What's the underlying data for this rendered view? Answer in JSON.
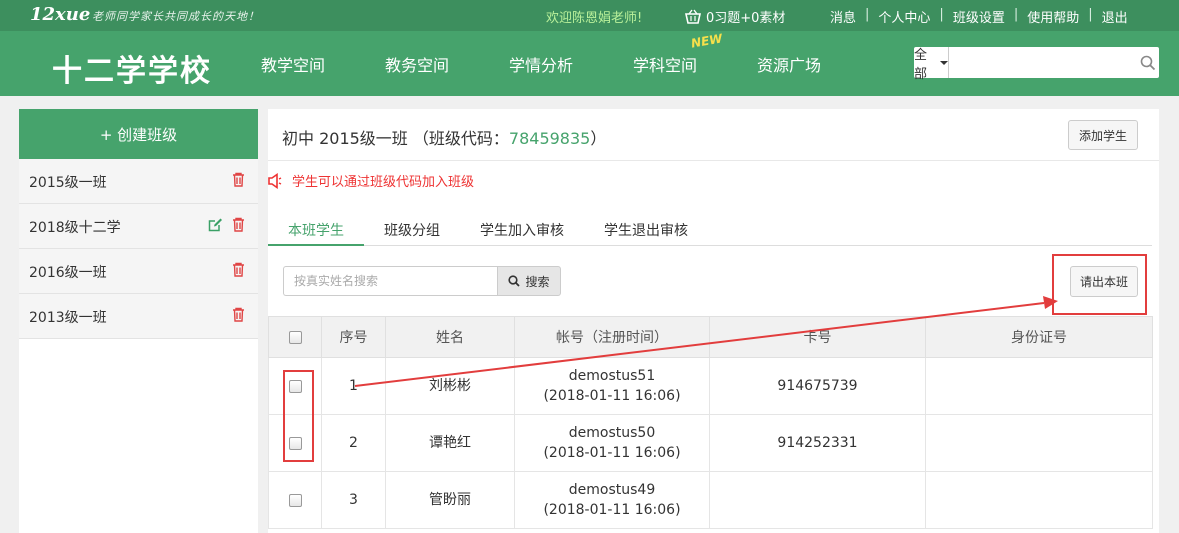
{
  "colors": {
    "top_strip": "#3d8f5e",
    "brand_green": "#46a36c",
    "alert_red": "#e33333",
    "annotation_red": "#e23d3d"
  },
  "topbar": {
    "logo": "12xue",
    "slogan": "老师同学家长共同成长的天地！",
    "welcome": "欢迎陈恩娟老师!",
    "basket_icon": "shopping-basket-icon",
    "basket_text": "0习题+0素材",
    "links": [
      "消息",
      "个人中心",
      "班级设置",
      "使用帮助",
      "退出"
    ]
  },
  "header": {
    "school": "十二学学校",
    "nav": [
      "教学空间",
      "教务空间",
      "学情分析",
      "学科空间",
      "资源广场"
    ],
    "new_badge": "NEW",
    "search_scope": "全部",
    "search_placeholder": "",
    "search_icon": "magnifier-icon"
  },
  "sidebar": {
    "create_label": "+ 创建班级",
    "classes": [
      {
        "name": "2015级一班",
        "editable": false
      },
      {
        "name": "2018级十二学",
        "editable": true
      },
      {
        "name": "2016级一班",
        "editable": false
      },
      {
        "name": "2013级一班",
        "editable": false
      }
    ]
  },
  "content": {
    "title_prefix": "初中 2015级一班 （班级代码：",
    "class_code": "78459835",
    "title_suffix": "）",
    "add_student": "添加学生",
    "notice": "学生可以通过班级代码加入班级",
    "tabs": [
      "本班学生",
      "班级分组",
      "学生加入审核",
      "学生退出审核"
    ],
    "active_tab": 0,
    "search_placeholder": "按真实姓名搜索",
    "search_button": "搜索",
    "kick_button": "请出本班",
    "table": {
      "headers": [
        "序号",
        "姓名",
        "帐号（注册时间）",
        "卡号",
        "身份证号"
      ],
      "rows": [
        {
          "no": "1",
          "name": "刘彬彬",
          "account": "demostus51",
          "time": "(2018-01-11 16:06)",
          "card": "914675739",
          "id": ""
        },
        {
          "no": "2",
          "name": "谭艳红",
          "account": "demostus50",
          "time": "(2018-01-11 16:06)",
          "card": "914252331",
          "id": ""
        },
        {
          "no": "3",
          "name": "管盼丽",
          "account": "demostus49",
          "time": "(2018-01-11 16:06)",
          "card": "",
          "id": ""
        }
      ]
    }
  }
}
